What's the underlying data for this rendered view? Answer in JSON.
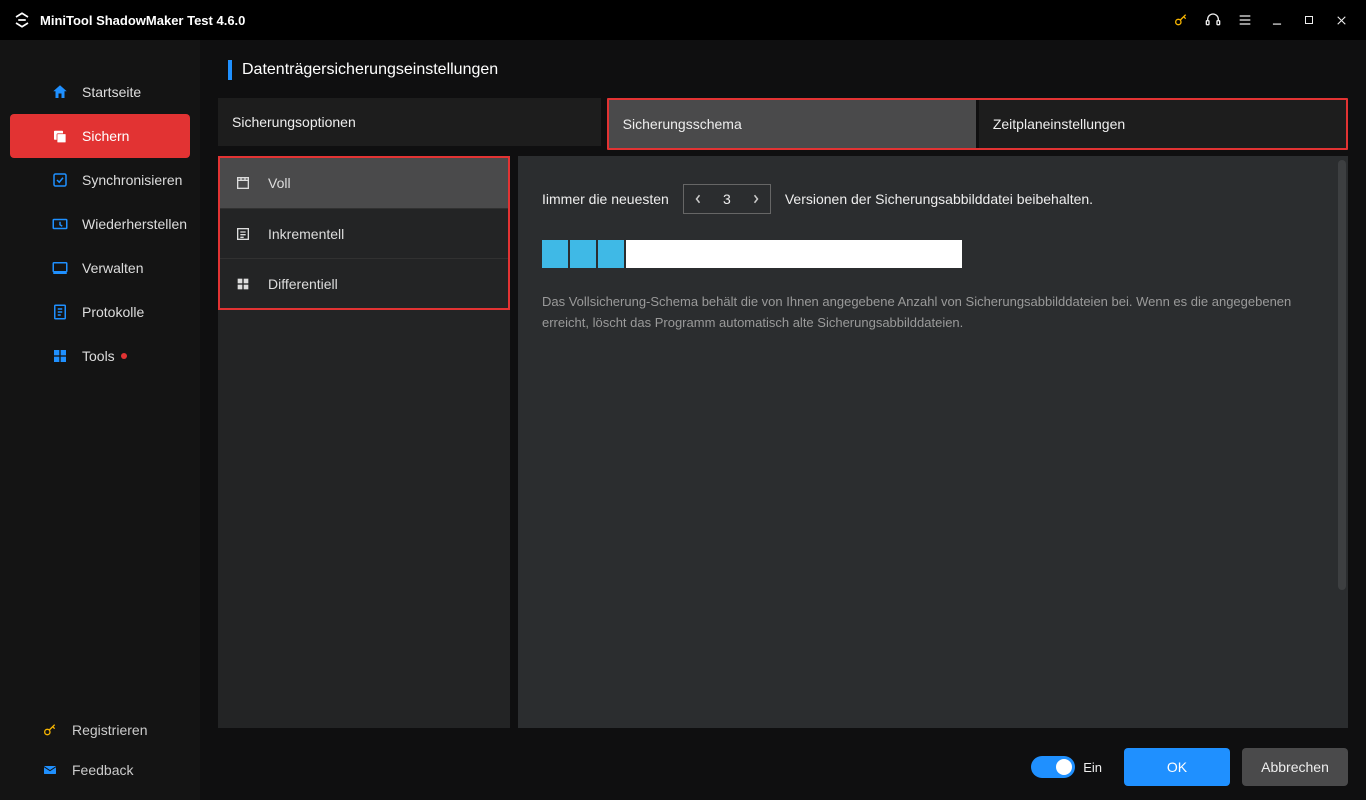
{
  "window": {
    "title": "MiniTool ShadowMaker Test 4.6.0"
  },
  "sidebar": {
    "items": [
      {
        "label": "Startseite"
      },
      {
        "label": "Sichern"
      },
      {
        "label": "Synchronisieren"
      },
      {
        "label": "Wiederherstellen"
      },
      {
        "label": "Verwalten"
      },
      {
        "label": "Protokolle"
      },
      {
        "label": "Tools"
      }
    ],
    "active_index": 1,
    "tools_has_indicator": true,
    "footer": {
      "register": "Registrieren",
      "feedback": "Feedback"
    }
  },
  "page": {
    "title": "Datenträgersicherungseinstellungen",
    "tabs": {
      "options": "Sicherungsoptionen",
      "scheme": "Sicherungsschema",
      "schedule": "Zeitplaneinstellungen",
      "selected": "scheme"
    },
    "schemes": {
      "full": "Voll",
      "incremental": "Inkrementell",
      "differential": "Differentiell",
      "selected": "full"
    },
    "keep": {
      "prefix": "Iimmer die neuesten",
      "value": 3,
      "suffix": "Versionen der Sicherungsabbilddatei beibehalten."
    },
    "segments_filled": 3,
    "description": "Das Vollsicherung-Schema behält die von Ihnen angegebene Anzahl von Sicherungsabbilddateien bei. Wenn es die angegebenen erreicht, löscht das Programm automatisch alte Sicherungsabbilddateien.",
    "toggle": {
      "on": true,
      "label": "Ein"
    },
    "buttons": {
      "ok": "OK",
      "cancel": "Abbrechen"
    }
  },
  "colors": {
    "accent_blue": "#1f90ff",
    "accent_red": "#e23333",
    "seg_blue": "#3fb9e6"
  }
}
